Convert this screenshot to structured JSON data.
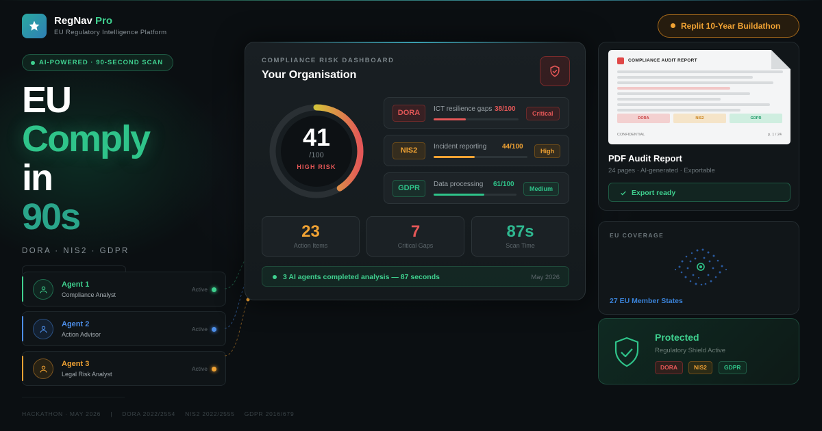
{
  "brand": {
    "name": "RegNav",
    "suffix": "Pro",
    "tagline": "EU Regulatory Intelligence Platform"
  },
  "hero": {
    "badge": "AI-POWERED · 90-SECOND SCAN",
    "line1": "EU",
    "line2": "Comply",
    "line3": "in",
    "line4": "90s",
    "frameworks": "DORA · NIS2 · GDPR"
  },
  "agents": [
    {
      "name": "Agent 1",
      "role": "Compliance Analyst",
      "status": "Active",
      "color": "#3fd08f"
    },
    {
      "name": "Agent 2",
      "role": "Action Advisor",
      "status": "Active",
      "color": "#4d8ee8"
    },
    {
      "name": "Agent 3",
      "role": "Legal Risk Analyst",
      "status": "Active",
      "color": "#f0a233"
    }
  ],
  "footer": {
    "event": "HACKATHON · MAY 2026",
    "sep": "|",
    "refs": [
      "DORA 2022/2554",
      "NIS2 2022/2555",
      "GDPR 2016/679"
    ]
  },
  "dashboard": {
    "label": "COMPLIANCE RISK DASHBOARD",
    "title": "Your Organisation",
    "score": "41",
    "score_den": "/100",
    "score_value": 41,
    "risk_level": "HIGH RISK",
    "regulations": [
      {
        "tag": "DORA",
        "desc": "ICT resilience gaps",
        "score": "38/100",
        "value": 38,
        "severity": "Critical",
        "color": "#e45757"
      },
      {
        "tag": "NIS2",
        "desc": "Incident reporting",
        "score": "44/100",
        "value": 44,
        "severity": "High",
        "color": "#f0a233"
      },
      {
        "tag": "GDPR",
        "desc": "Data processing",
        "score": "61/100",
        "value": 61,
        "severity": "Medium",
        "color": "#2fc48a"
      }
    ],
    "stats": [
      {
        "value": "23",
        "label": "Action Items",
        "color": "#f0a233"
      },
      {
        "value": "7",
        "label": "Critical Gaps",
        "color": "#e45757"
      },
      {
        "value": "87s",
        "label": "Scan Time",
        "color": "#2fb890"
      }
    ],
    "completion": "3 AI agents completed analysis — 87 seconds",
    "completion_date": "May 2026"
  },
  "buildathon": "Replit 10-Year Buildathon",
  "report": {
    "doc_title": "COMPLIANCE AUDIT REPORT",
    "chips": [
      "DORA",
      "NIS2",
      "GDPR"
    ],
    "confidential": "CONFIDENTIAL",
    "page": "p. 1 / 24",
    "title": "PDF Audit Report",
    "meta": "24 pages · AI-generated · Exportable",
    "export": "Export ready"
  },
  "coverage": {
    "label": "EU COVERAGE",
    "states": "27 EU Member States"
  },
  "protected": {
    "title": "Protected",
    "subtitle": "Regulatory Shield Active",
    "chips": [
      "DORA",
      "NIS2",
      "GDPR"
    ]
  }
}
